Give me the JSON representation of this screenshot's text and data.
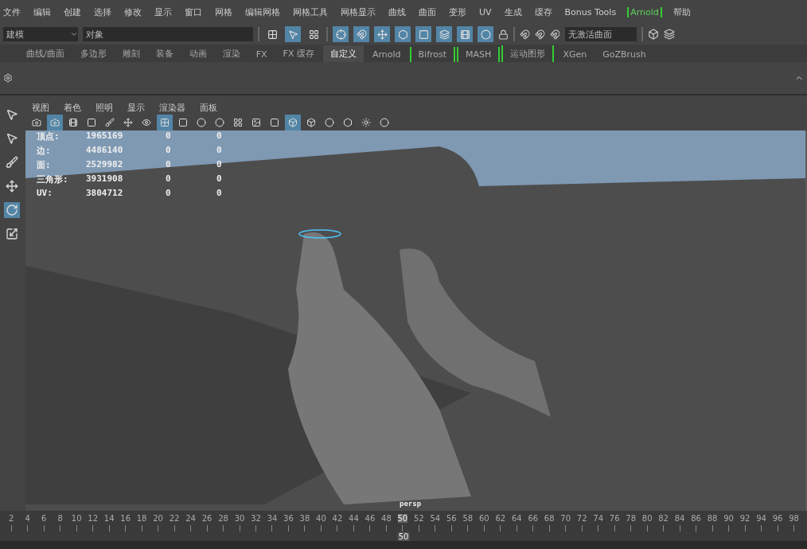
{
  "menu_bar": [
    "文件",
    "编辑",
    "创建",
    "选择",
    "修改",
    "显示",
    "窗口",
    "网格",
    "编辑网格",
    "网格工具",
    "网格显示",
    "曲线",
    "曲面",
    "变形",
    "UV",
    "生成",
    "缓存",
    "Bonus Tools",
    {
      "label": "Arnold",
      "bracketed": true
    },
    "帮助"
  ],
  "status_line": {
    "mode": "建模",
    "object_field": "对象",
    "select_tools": [
      {
        "selected": false
      },
      {
        "selected": true
      },
      {
        "selected": false
      }
    ],
    "snap_tools": [
      {
        "selected": true
      },
      {
        "selected": true
      },
      {
        "selected": true
      },
      {
        "selected": true
      },
      {
        "selected": true
      },
      {
        "selected": true
      },
      {
        "selected": true
      },
      {
        "selected": true
      }
    ],
    "live_surface": "无激活曲面"
  },
  "shelf_tabs": [
    {
      "label": "曲线/曲面",
      "selected": false
    },
    {
      "label": "多边形",
      "selected": false
    },
    {
      "label": "雕刻",
      "selected": false
    },
    {
      "label": "装备",
      "selected": false
    },
    {
      "label": "动画",
      "selected": false
    },
    {
      "label": "渲染",
      "selected": false
    },
    {
      "label": "FX",
      "selected": false
    },
    {
      "label": "FX 缓存",
      "selected": false
    },
    {
      "label": "自定义",
      "selected": true
    },
    {
      "label": "Arnold",
      "selected": false
    },
    {
      "label": "Bifrost",
      "selected": false,
      "bracketed": true
    },
    {
      "label": "MASH",
      "selected": false,
      "bracketed": true
    },
    {
      "label": "运动图形",
      "selected": false,
      "bracketed": true
    },
    {
      "label": "XGen",
      "selected": false
    },
    {
      "label": "GoZBrush",
      "selected": false
    }
  ],
  "toolbox": [
    {
      "selected": false
    },
    {
      "selected": false
    },
    {
      "selected": false
    },
    {
      "selected": false
    },
    {
      "selected": true
    },
    {
      "selected": false
    }
  ],
  "viewport": {
    "menu": [
      "视图",
      "着色",
      "照明",
      "显示",
      "渲染器",
      "面板"
    ],
    "toolbar": [
      {
        "selected": false
      },
      {
        "selected": true
      },
      {
        "selected": false
      },
      {
        "selected": false
      },
      {
        "selected": false
      },
      {
        "selected": false
      },
      {
        "selected": false
      },
      {
        "selected": true
      },
      {
        "selected": false
      },
      {
        "selected": false
      },
      {
        "selected": false
      },
      {
        "selected": false
      },
      {
        "selected": false
      },
      {
        "selected": false
      },
      {
        "selected": true
      },
      {
        "selected": false
      },
      {
        "selected": false
      },
      {
        "selected": false
      },
      {
        "selected": false
      },
      {
        "selected": false
      }
    ],
    "hud": [
      [
        "顶点:",
        "1965169",
        "0",
        "0"
      ],
      [
        "边:",
        "4486140",
        "0",
        "0"
      ],
      [
        "面:",
        "2529982",
        "0",
        "0"
      ],
      [
        "三角形:",
        "3931908",
        "0",
        "0"
      ],
      [
        "UV:",
        "3804712",
        "0",
        "0"
      ]
    ],
    "camera": "persp"
  },
  "timeline": {
    "ticks": [
      {
        "label": "2",
        "selected": false
      },
      {
        "label": "4",
        "selected": false
      },
      {
        "label": "6",
        "selected": false
      },
      {
        "label": "8",
        "selected": false
      },
      {
        "label": "10",
        "selected": false
      },
      {
        "label": "12",
        "selected": false
      },
      {
        "label": "14",
        "selected": false
      },
      {
        "label": "16",
        "selected": false
      },
      {
        "label": "18",
        "selected": false
      },
      {
        "label": "20",
        "selected": false
      },
      {
        "label": "22",
        "selected": false
      },
      {
        "label": "24",
        "selected": false
      },
      {
        "label": "26",
        "selected": false
      },
      {
        "label": "28",
        "selected": false
      },
      {
        "label": "30",
        "selected": false
      },
      {
        "label": "32",
        "selected": false
      },
      {
        "label": "34",
        "selected": false
      },
      {
        "label": "36",
        "selected": false
      },
      {
        "label": "38",
        "selected": false
      },
      {
        "label": "40",
        "selected": false
      },
      {
        "label": "42",
        "selected": false
      },
      {
        "label": "44",
        "selected": false
      },
      {
        "label": "46",
        "selected": false
      },
      {
        "label": "48",
        "selected": false
      },
      {
        "label": "50",
        "selected": true
      },
      {
        "label": "52",
        "selected": false
      },
      {
        "label": "54",
        "selected": false
      },
      {
        "label": "56",
        "selected": false
      },
      {
        "label": "58",
        "selected": false
      },
      {
        "label": "60",
        "selected": false
      },
      {
        "label": "62",
        "selected": false
      },
      {
        "label": "64",
        "selected": false
      },
      {
        "label": "66",
        "selected": false
      },
      {
        "label": "68",
        "selected": false
      },
      {
        "label": "70",
        "selected": false
      },
      {
        "label": "72",
        "selected": false
      },
      {
        "label": "74",
        "selected": false
      },
      {
        "label": "76",
        "selected": false
      },
      {
        "label": "78",
        "selected": false
      },
      {
        "label": "80",
        "selected": false
      },
      {
        "label": "82",
        "selected": false
      },
      {
        "label": "84",
        "selected": false
      },
      {
        "label": "86",
        "selected": false
      },
      {
        "label": "88",
        "selected": false
      },
      {
        "label": "90",
        "selected": false
      },
      {
        "label": "92",
        "selected": false
      },
      {
        "label": "94",
        "selected": false
      },
      {
        "label": "96",
        "selected": false
      },
      {
        "label": "98",
        "selected": false
      }
    ],
    "current": "50"
  }
}
